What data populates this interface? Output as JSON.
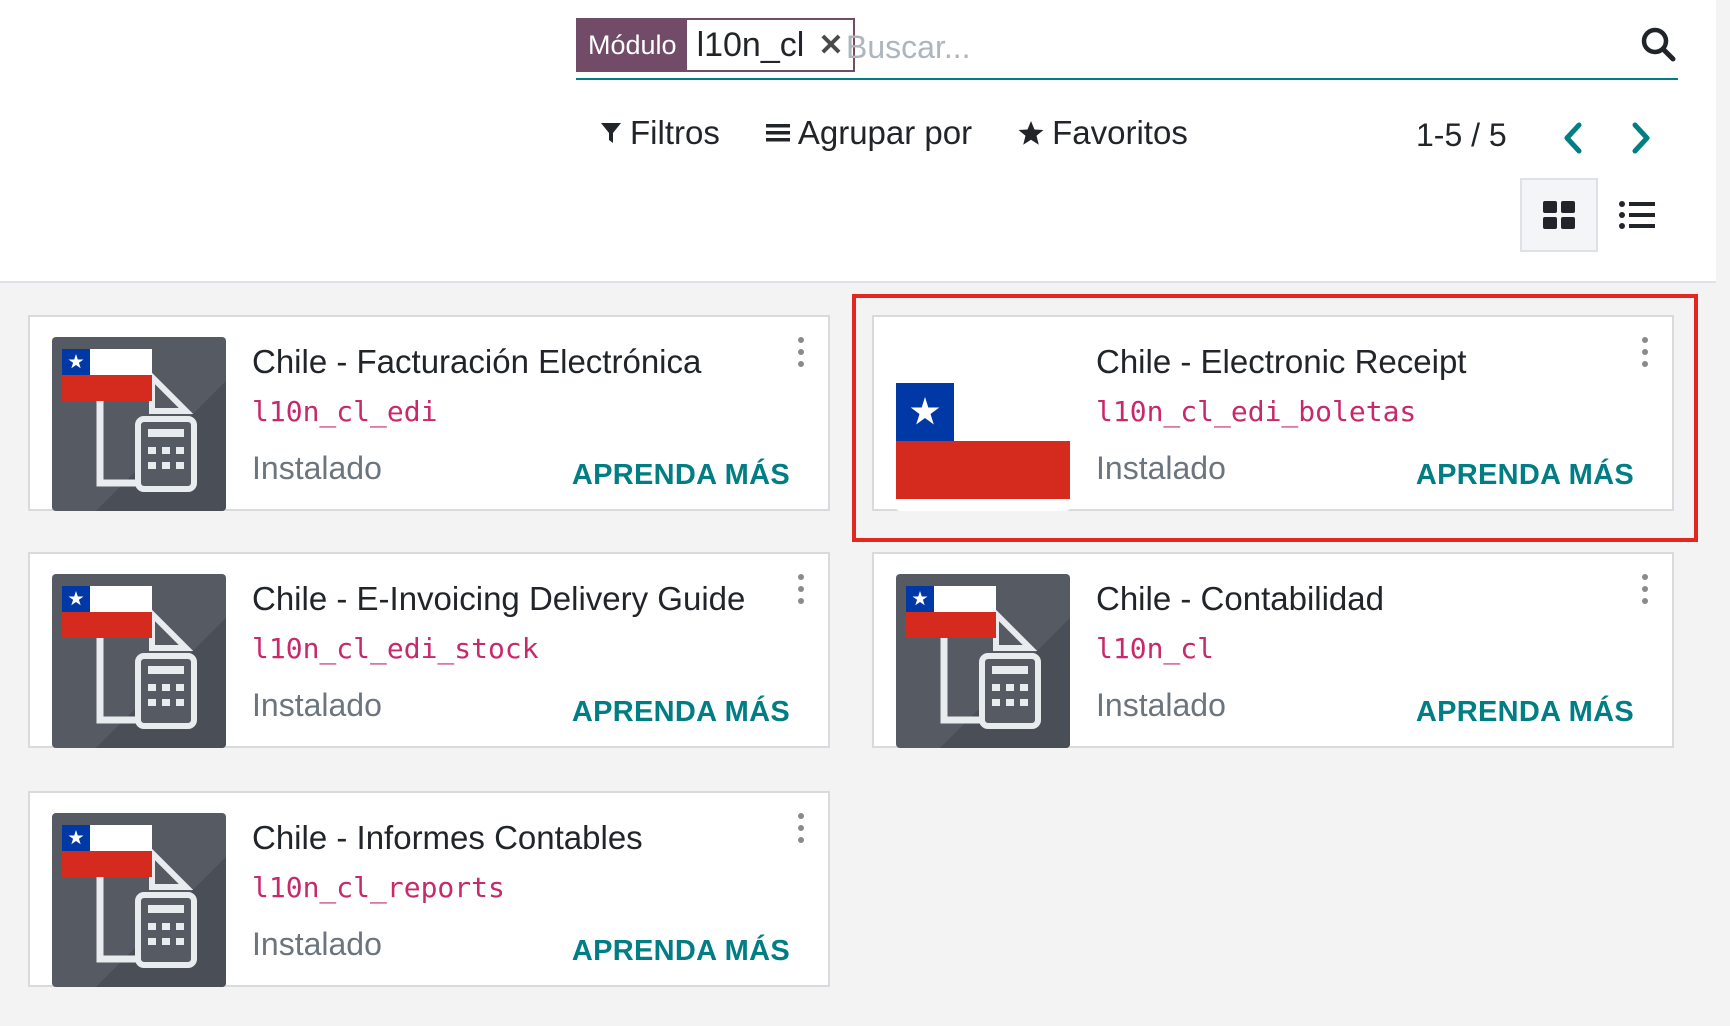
{
  "search": {
    "facet_label": "Módulo",
    "facet_value": "l10n_cl",
    "placeholder": "Buscar..."
  },
  "filters": {
    "filters_label": "Filtros",
    "group_by_label": "Agrupar por",
    "favorites_label": "Favoritos"
  },
  "pager": {
    "value": "1-5 / 5"
  },
  "views": [
    "kanban",
    "list"
  ],
  "modules": [
    {
      "title": "Chile - Facturación Electrónica",
      "technical_name": "l10n_cl_edi",
      "status": "Instalado",
      "action": "APRENDA MÁS",
      "icon": "chile-invoice-icon"
    },
    {
      "title": "Chile - Electronic Receipt",
      "technical_name": "l10n_cl_edi_boletas",
      "status": "Instalado",
      "action": "APRENDA MÁS",
      "icon": "chile-flag-icon",
      "highlighted": true
    },
    {
      "title": "Chile - E-Invoicing Delivery Guide",
      "technical_name": "l10n_cl_edi_stock",
      "status": "Instalado",
      "action": "APRENDA MÁS",
      "icon": "chile-invoice-icon"
    },
    {
      "title": "Chile - Contabilidad",
      "technical_name": "l10n_cl",
      "status": "Instalado",
      "action": "APRENDA MÁS",
      "icon": "chile-invoice-icon"
    },
    {
      "title": "Chile - Informes Contables",
      "technical_name": "l10n_cl_reports",
      "status": "Instalado",
      "action": "APRENDA MÁS",
      "icon": "chile-invoice-icon"
    }
  ],
  "colors": {
    "brand": "#714b67",
    "accent": "#017e84",
    "technical_name": "#c8296c",
    "highlight": "#e2271f"
  }
}
